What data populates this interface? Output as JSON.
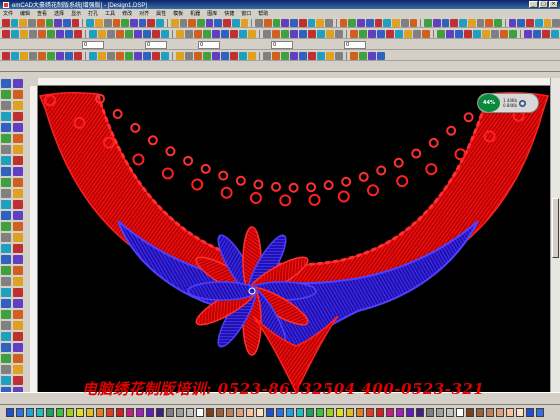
{
  "window": {
    "title": "emCAD大豪绣花制版系统[增强版] - [Design1.DSP]"
  },
  "menu": {
    "items": [
      "文件",
      "编辑",
      "查看",
      "选择",
      "显示",
      "打孔",
      "工具",
      "修改",
      "对齐",
      "属性",
      "模板",
      "机器",
      "图库",
      "快捷",
      "窗口",
      "帮助"
    ]
  },
  "toolbar": {
    "field_1": "0",
    "field_2": "0",
    "field_3": "0",
    "field_4": "0",
    "field_5": "0"
  },
  "stitch_counter": {
    "percent": "44%",
    "line_1": "1.44Kb",
    "line_2": "0.84Kb"
  },
  "watermark": {
    "text": "电脑绣花制版培训: 0523-86332504   400-0523-321"
  },
  "palette": {
    "colors": [
      "#2050d0",
      "#3070e0",
      "#20a0e0",
      "#20c0c0",
      "#20a060",
      "#40c040",
      "#a0d020",
      "#e0e020",
      "#e0c020",
      "#e08020",
      "#e04020",
      "#d02020",
      "#c02080",
      "#a020c0",
      "#6020c0",
      "#402080",
      "#808080",
      "#a0a0a0",
      "#c0c0c0",
      "#ffffff",
      "#804020",
      "#a06040",
      "#c08060",
      "#e0a080",
      "#ffc0a0",
      "#ffe0c0",
      "#2050d0",
      "#3070e0",
      "#20a0e0",
      "#20c0c0",
      "#20a060",
      "#40c040",
      "#a0d020",
      "#e0e020",
      "#e0c020",
      "#e08020",
      "#e04020",
      "#d02020",
      "#c02080",
      "#a020c0",
      "#6020c0",
      "#402080",
      "#808080",
      "#a0a0a0",
      "#c0c0c0",
      "#ffffff",
      "#804020",
      "#a06040",
      "#c08060",
      "#e0a080",
      "#ffc0a0",
      "#ffe0c0",
      "#2050d0",
      "#3070e0"
    ]
  },
  "design_colors": {
    "outer_lace": "#ff1010",
    "inner_motif": "#3a2cff",
    "background": "#000000"
  }
}
